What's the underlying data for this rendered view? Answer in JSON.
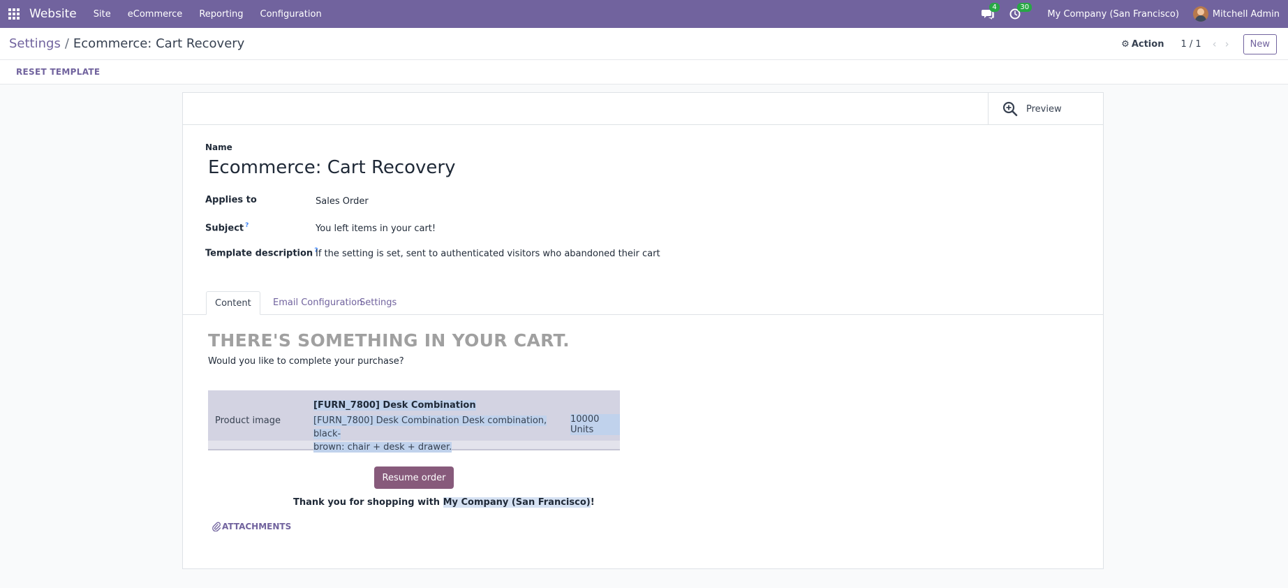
{
  "navbar": {
    "app_name": "Website",
    "menu": [
      "Site",
      "eCommerce",
      "Reporting",
      "Configuration"
    ],
    "messages_count": "4",
    "activities_count": "30",
    "company": "My Company (San Francisco)",
    "user": "Mitchell Admin"
  },
  "breadcrumb": {
    "parent": "Settings",
    "separator": "/",
    "current": "Ecommerce: Cart Recovery"
  },
  "control": {
    "action_label": "Action",
    "pager": "1 / 1",
    "new_label": "New"
  },
  "statusbar": {
    "reset_label": "RESET TEMPLATE"
  },
  "form": {
    "preview_label": "Preview",
    "name_label": "Name",
    "name_value": "Ecommerce: Cart Recovery",
    "applies_to_label": "Applies to",
    "applies_to_value": "Sales Order",
    "subject_label": "Subject",
    "subject_value": "You left items in your cart!",
    "description_label": "Template description",
    "description_value": "If the setting is set, sent to authenticated visitors who abandoned their cart",
    "help_mark": "?"
  },
  "tabs": [
    "Content",
    "Email Configuration",
    "Settings"
  ],
  "email": {
    "heading": "THERE'S SOMETHING IN YOUR CART.",
    "subheading": "Would you like to complete your purchase?",
    "product_image_label": "Product image",
    "product_name": "[FURN_7800] Desk Combination",
    "product_desc_line1": "[FURN_7800] Desk Combination Desk combination, black-",
    "product_desc_line2": "brown: chair + desk + drawer.",
    "product_qty": "10000 Units",
    "resume_label": "Resume order",
    "thanks_prefix": "Thank you for shopping with ",
    "thanks_company": "My Company (San Francisco)",
    "thanks_suffix": "!",
    "attachments_label": "ATTACHMENTS"
  },
  "colors": {
    "brand": "#71639e",
    "resume_button": "#875a7b",
    "badge": "#28a745"
  }
}
